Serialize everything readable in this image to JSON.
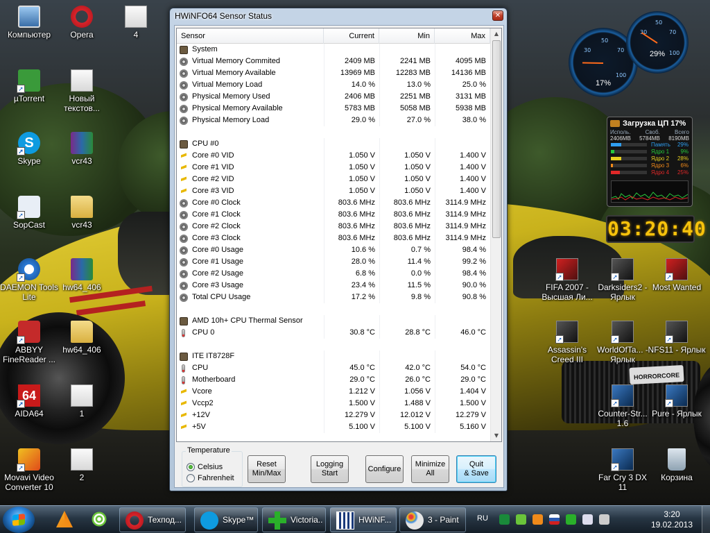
{
  "desktop": {
    "icons": [
      {
        "label": "Компьютер",
        "icon": "computer-icon"
      },
      {
        "label": "Opera",
        "icon": "opera-icon"
      },
      {
        "label": "4",
        "icon": "image-file-icon"
      },
      {
        "label": "µTorrent",
        "icon": "utorrent-icon"
      },
      {
        "label": "Новый текстов...",
        "icon": "text-document-icon"
      },
      {
        "label": "Skype",
        "icon": "skype-icon"
      },
      {
        "label": "vcr43",
        "icon": "winrar-archive-icon"
      },
      {
        "label": "SopCast",
        "icon": "sopcast-icon"
      },
      {
        "label": "vcr43",
        "icon": "folder-icon"
      },
      {
        "label": "DAEMON Tools Lite",
        "icon": "daemon-tools-icon"
      },
      {
        "label": "hw64_406",
        "icon": "winrar-archive-icon"
      },
      {
        "label": "ABBYY FineReader ...",
        "icon": "abbyy-icon"
      },
      {
        "label": "hw64_406",
        "icon": "folder-icon"
      },
      {
        "label": "AIDA64",
        "icon": "aida64-icon"
      },
      {
        "label": "1",
        "icon": "image-file-icon"
      },
      {
        "label": "Movavi Video Converter 10",
        "icon": "movavi-icon"
      },
      {
        "label": "2",
        "icon": "image-file-icon"
      },
      {
        "label": "FIFA 2007 - Высшая Ли...",
        "icon": "fifa-icon"
      },
      {
        "label": "Darksiders2 - Ярлык",
        "icon": "darksiders-icon"
      },
      {
        "label": "Most Wanted",
        "icon": "need-for-speed-icon"
      },
      {
        "label": "Assassin's Creed III",
        "icon": "assassins-creed-icon"
      },
      {
        "label": "WorldOfTa... - Ярлык",
        "icon": "world-of-tanks-icon"
      },
      {
        "label": "NFS11 - Ярлык",
        "icon": "nfs-icon"
      },
      {
        "label": "Counter-Str... 1.6",
        "icon": "counter-strike-icon"
      },
      {
        "label": "Pure - Ярлык",
        "icon": "pure-icon"
      },
      {
        "label": "Far Cry 3 DX 11",
        "icon": "far-cry-icon"
      },
      {
        "label": "Корзина",
        "icon": "recycle-bin-icon"
      }
    ],
    "wallpaper_sticker": "HORRORCORE"
  },
  "gauges": {
    "cpu_gauge": {
      "percent_label": "17%",
      "value": 17,
      "ticks": [
        "30",
        "50",
        "70",
        "100"
      ]
    },
    "memory_gauge": {
      "percent_label": "29%",
      "value": 29,
      "ticks": [
        "30",
        "50",
        "70",
        "100"
      ]
    }
  },
  "cpu_meter": {
    "title": "Загрузка ЦП",
    "title_value": "17%",
    "headers": [
      "Исполь.",
      "Своб.",
      "Всего"
    ],
    "values": [
      "2406MB",
      "5784MB",
      "8190MB"
    ],
    "rows": [
      {
        "label": "Память",
        "value": "29%",
        "fraction": 0.29,
        "color": "#2f9ef0"
      },
      {
        "label": "Ядро 1",
        "value": "9%",
        "fraction": 0.09,
        "color": "#28c83c"
      },
      {
        "label": "Ядро 2",
        "value": "28%",
        "fraction": 0.28,
        "color": "#e8d020"
      },
      {
        "label": "Ядро 3",
        "value": "6%",
        "fraction": 0.06,
        "color": "#f08a1a"
      },
      {
        "label": "Ядро 4",
        "value": "25%",
        "fraction": 0.25,
        "color": "#e02828"
      }
    ]
  },
  "clock_widget": {
    "time": "03:20:40"
  },
  "hwinfo": {
    "title": "HWiNFO64 Sensor Status",
    "columns": {
      "sensor": "Sensor",
      "current": "Current",
      "min": "Min",
      "max": "Max"
    },
    "rows": [
      {
        "type": "group",
        "icon": "chip",
        "name": "System"
      },
      {
        "icon": "clock",
        "name": "Virtual Memory Commited",
        "current": "2409 MB",
        "min": "2241 MB",
        "max": "4095 MB"
      },
      {
        "icon": "clock",
        "name": "Virtual Memory Available",
        "current": "13969 MB",
        "min": "12283 MB",
        "max": "14136 MB"
      },
      {
        "icon": "clock",
        "name": "Virtual Memory Load",
        "current": "14.0 %",
        "min": "13.0 %",
        "max": "25.0 %"
      },
      {
        "icon": "clock",
        "name": "Physical Memory Used",
        "current": "2406 MB",
        "min": "2251 MB",
        "max": "3131 MB"
      },
      {
        "icon": "clock",
        "name": "Physical Memory Available",
        "current": "5783 MB",
        "min": "5058 MB",
        "max": "5938 MB"
      },
      {
        "icon": "clock",
        "name": "Physical Memory Load",
        "current": "29.0 %",
        "min": "27.0 %",
        "max": "38.0 %"
      },
      {
        "type": "blank"
      },
      {
        "type": "group",
        "icon": "chip",
        "name": "CPU #0"
      },
      {
        "icon": "volt",
        "name": "Core #0 VID",
        "current": "1.050 V",
        "min": "1.050 V",
        "max": "1.400 V"
      },
      {
        "icon": "volt",
        "name": "Core #1 VID",
        "current": "1.050 V",
        "min": "1.050 V",
        "max": "1.400 V"
      },
      {
        "icon": "volt",
        "name": "Core #2 VID",
        "current": "1.050 V",
        "min": "1.050 V",
        "max": "1.400 V"
      },
      {
        "icon": "volt",
        "name": "Core #3 VID",
        "current": "1.050 V",
        "min": "1.050 V",
        "max": "1.400 V"
      },
      {
        "icon": "clock",
        "name": "Core #0 Clock",
        "current": "803.6 MHz",
        "min": "803.6 MHz",
        "max": "3114.9 MHz"
      },
      {
        "icon": "clock",
        "name": "Core #1 Clock",
        "current": "803.6 MHz",
        "min": "803.6 MHz",
        "max": "3114.9 MHz"
      },
      {
        "icon": "clock",
        "name": "Core #2 Clock",
        "current": "803.6 MHz",
        "min": "803.6 MHz",
        "max": "3114.9 MHz"
      },
      {
        "icon": "clock",
        "name": "Core #3 Clock",
        "current": "803.6 MHz",
        "min": "803.6 MHz",
        "max": "3114.9 MHz"
      },
      {
        "icon": "clock",
        "name": "Core #0 Usage",
        "current": "10.6 %",
        "min": "0.7 %",
        "max": "98.4 %"
      },
      {
        "icon": "clock",
        "name": "Core #1 Usage",
        "current": "28.0 %",
        "min": "11.4 %",
        "max": "99.2 %"
      },
      {
        "icon": "clock",
        "name": "Core #2 Usage",
        "current": "6.8 %",
        "min": "0.0 %",
        "max": "98.4 %"
      },
      {
        "icon": "clock",
        "name": "Core #3 Usage",
        "current": "23.4 %",
        "min": "11.5 %",
        "max": "90.0 %"
      },
      {
        "icon": "clock",
        "name": "Total CPU Usage",
        "current": "17.2 %",
        "min": "9.8 %",
        "max": "90.8 %"
      },
      {
        "type": "blank"
      },
      {
        "type": "group",
        "icon": "chip",
        "name": "AMD 10h+ CPU Thermal Sensor"
      },
      {
        "icon": "therm",
        "name": "CPU 0",
        "current": "30.8 °C",
        "min": "28.8 °C",
        "max": "46.0 °C"
      },
      {
        "type": "blank"
      },
      {
        "type": "group",
        "icon": "chip",
        "name": "ITE IT8728F"
      },
      {
        "icon": "therm",
        "name": "CPU",
        "current": "45.0 °C",
        "min": "42.0 °C",
        "max": "54.0 °C"
      },
      {
        "icon": "therm",
        "name": "Motherboard",
        "current": "29.0 °C",
        "min": "26.0 °C",
        "max": "29.0 °C"
      },
      {
        "icon": "volt",
        "name": "Vcore",
        "current": "1.212 V",
        "min": "1.056 V",
        "max": "1.404 V"
      },
      {
        "icon": "volt",
        "name": "Vccp2",
        "current": "1.500 V",
        "min": "1.488 V",
        "max": "1.500 V"
      },
      {
        "icon": "volt",
        "name": "+12V",
        "current": "12.279 V",
        "min": "12.012 V",
        "max": "12.279 V"
      },
      {
        "icon": "volt",
        "name": "+5V",
        "current": "5.100 V",
        "min": "5.100 V",
        "max": "5.160 V"
      }
    ],
    "temperature": {
      "legend": "Temperature",
      "options": [
        "Celsius",
        "Fahrenheit"
      ],
      "selected": "Celsius"
    },
    "buttons": {
      "reset": "Reset\nMin/Max",
      "logging": "Logging\nStart",
      "configure": "Configure",
      "minimize": "Minimize\nAll",
      "quit": "Quit\n& Save"
    }
  },
  "taskbar": {
    "pinned": [
      "vlc-icon",
      "wifi-manager-icon"
    ],
    "items": [
      {
        "label": "Техпод...",
        "icon": "opera-icon",
        "active": false
      },
      {
        "label": "Skype™...",
        "icon": "skype-icon",
        "active": false
      },
      {
        "label": "Victoria...",
        "icon": "victoria-icon",
        "active": false
      },
      {
        "label": "HWiNF...",
        "icon": "hwinfo-icon",
        "active": true
      },
      {
        "label": "3 - Paint",
        "icon": "paint-icon",
        "active": false
      }
    ],
    "language": "RU",
    "tray_icons": [
      "utorrent-tray-icon",
      "shield-tray-icon",
      "orange-tray-icon",
      "flag-tray-icon",
      "keyboard-tray-icon",
      "network-tray-icon",
      "volume-tray-icon"
    ],
    "clock_time": "3:20",
    "clock_date": "19.02.2013"
  }
}
